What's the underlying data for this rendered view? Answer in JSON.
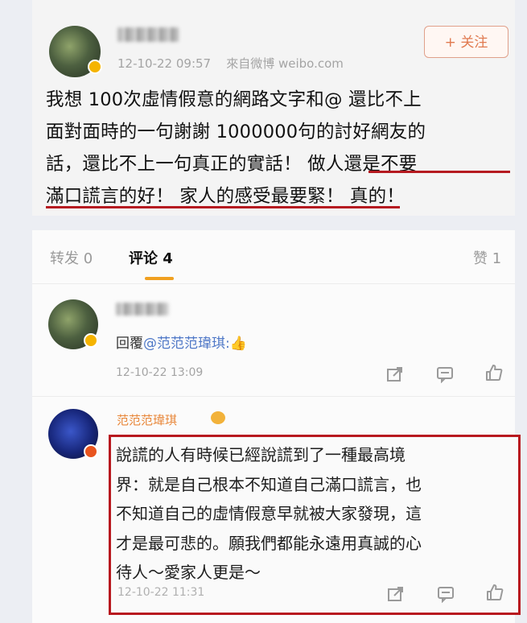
{
  "post": {
    "timestamp": "12-10-22 09:57",
    "source": "來自微博 weibo.com",
    "follow_label": "+ 关注",
    "lines": [
      "我想 100次虛情假意的網路文字和@ 還比不上",
      "面對面時的一句謝謝 1000000句的討好網友的",
      "話，還比不上一句真正的實話！ 做人還是不要",
      "滿口謊言的好！ 家人的感受最要緊！ 真的！"
    ]
  },
  "tabs": {
    "repost": "转发 0",
    "comment": "评论 4",
    "like": "赞 1"
  },
  "comments": [
    {
      "reply_prefix": "回覆",
      "mention": "@范范范瑋琪:",
      "emoji": "👍",
      "timestamp": "12-10-22 13:09"
    },
    {
      "author": "范范范瑋琪",
      "lines": [
        "說謊的人有時候已經說謊到了一種最高境",
        "界：就是自己根本不知道自己滿口謊言，也",
        "不知道自己的虛情假意早就被大家發現，這",
        "才是最可悲的。願我們都能永遠用真誠的心",
        "待人～愛家人更是～"
      ],
      "timestamp": "12-10-22 11:31"
    }
  ],
  "colors": {
    "highlight_red": "#b51a20",
    "follow_orange": "#e07a50",
    "tab_underline": "#f0a020",
    "mention_blue": "#4f78c7",
    "author_orange": "#e8873a"
  },
  "icons": {
    "share": "share-icon",
    "comment": "comment-icon",
    "like": "thumbs-up-icon"
  }
}
